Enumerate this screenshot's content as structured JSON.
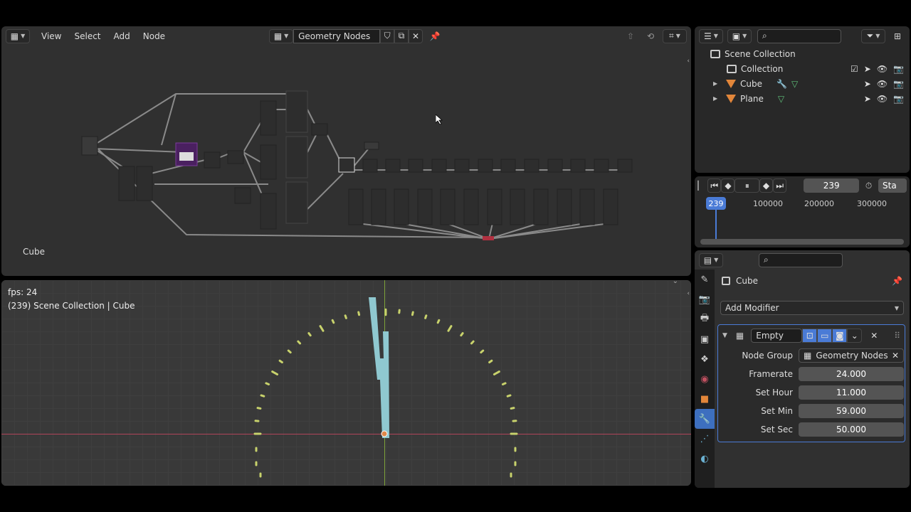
{
  "node_editor": {
    "menus": [
      "View",
      "Select",
      "Add",
      "Node"
    ],
    "node_tree_name": "Geometry Nodes",
    "object_label": "Cube"
  },
  "viewport": {
    "fps_text": "fps: 24",
    "info_text": "(239) Scene Collection | Cube"
  },
  "outliner": {
    "rows": [
      {
        "label": "Scene Collection"
      },
      {
        "label": "Collection"
      },
      {
        "label": "Cube"
      },
      {
        "label": "Plane"
      }
    ]
  },
  "timeline": {
    "current_frame": "239",
    "start_label": "Sta",
    "ruler_labels": [
      "100000",
      "200000",
      "300000"
    ]
  },
  "properties": {
    "object_name": "Cube",
    "add_modifier_label": "Add Modifier",
    "modifier_name": "Empty",
    "fields": [
      {
        "label": "Node Group",
        "value": "Geometry Nodes"
      },
      {
        "label": "Framerate",
        "value": "24.000"
      },
      {
        "label": "Set Hour",
        "value": "11.000"
      },
      {
        "label": "Set Min",
        "value": "59.000"
      },
      {
        "label": "Set Sec",
        "value": "50.000"
      }
    ]
  },
  "colors": {
    "accent": "#4a7bd6",
    "clock_hand": "#8fc8d0",
    "tick": "#c8d26c",
    "x_axis": "#b0455a",
    "y_axis": "#7da23a"
  }
}
